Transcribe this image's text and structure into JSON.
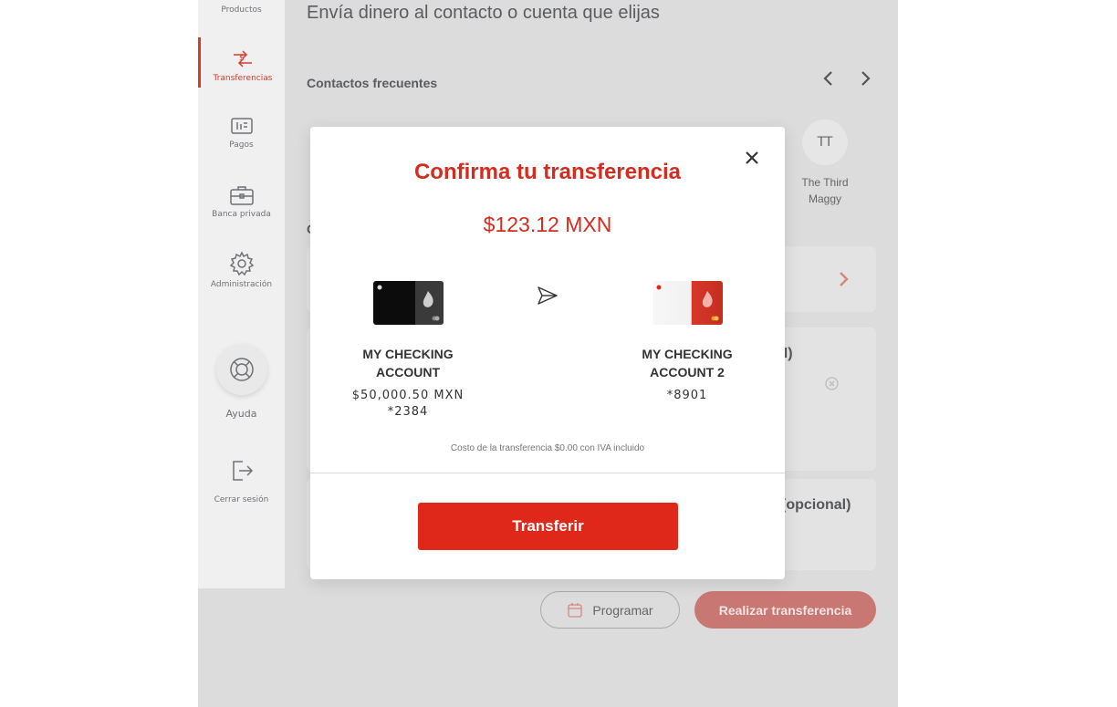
{
  "sidebar": {
    "items": [
      {
        "label": "Productos",
        "icon": "products-icon"
      },
      {
        "label": "Transferencias",
        "icon": "transfer-icon",
        "active": true
      },
      {
        "label": "Pagos",
        "icon": "payments-icon"
      },
      {
        "label": "Banca privada",
        "icon": "briefcase-icon"
      },
      {
        "label": "Administración",
        "icon": "gear-icon"
      }
    ],
    "help_label": "Ayuda",
    "logout_label": "Cerrar sesión"
  },
  "main": {
    "subtitle": "Envía dinero al contacto o cuenta que elijas",
    "frequent_title": "Contactos frecuentes",
    "contact": {
      "initials": "TT",
      "name_line1": "The Third",
      "name_line2": "Maggy"
    },
    "partial_text_1": "XN)",
    "partial_text_2": "(opcional)",
    "partial_text_3": "C"
  },
  "buttons": {
    "schedule": "Programar",
    "make_transfer": "Realizar transferencia"
  },
  "modal": {
    "title": "Confirma tu transferencia",
    "amount": "$123.12 MXN",
    "from": {
      "name": "MY CHECKING ACCOUNT",
      "balance": "$50,000.50 MXN",
      "number": "*2384"
    },
    "to": {
      "name": "MY CHECKING ACCOUNT 2",
      "number": "*8901"
    },
    "fee": "Costo de la transferencia $0.00 con IVA incluido",
    "confirm": "Transferir"
  },
  "colors": {
    "accent": "#e0281a",
    "muted_accent": "#c97773"
  }
}
